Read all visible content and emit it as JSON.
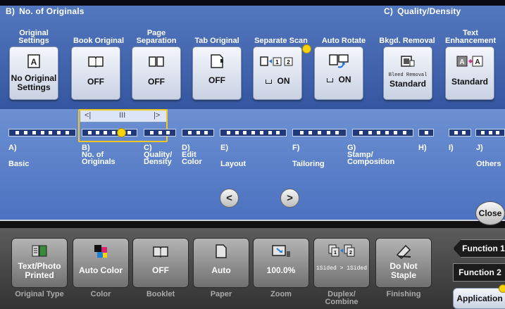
{
  "sections": {
    "b": {
      "letter": "B)",
      "title": "No. of Originals"
    },
    "c": {
      "letter": "C)",
      "title": "Quality/Density"
    }
  },
  "functions": [
    {
      "header": "Original Settings",
      "label": "No Original Settings",
      "icon": "original-settings-icon"
    },
    {
      "header": "Book Original",
      "label": "OFF",
      "icon": "book-original-icon"
    },
    {
      "header": "Page Separation",
      "label": "OFF",
      "icon": "page-separation-icon"
    },
    {
      "header": "Tab Original",
      "label": "OFF",
      "icon": "tab-original-icon"
    },
    {
      "header": "Separate Scan",
      "label": "ON",
      "icon": "separate-scan-icon"
    },
    {
      "header": "Auto Rotate",
      "label": "ON",
      "icon": "auto-rotate-icon"
    },
    {
      "header": "Bkgd. Removal",
      "label": "Standard",
      "sub": "Bleed Removal",
      "icon": "background-removal-icon"
    },
    {
      "header": "Text Enhancement",
      "label": "Standard",
      "icon": "text-enhancement-icon"
    }
  ],
  "menu": [
    {
      "letter": "A)",
      "label": "Basic"
    },
    {
      "letter": "B)",
      "label": "No. of Originals"
    },
    {
      "letter": "C)",
      "label": "Quality/ Density"
    },
    {
      "letter": "D)",
      "label": "Edit Color"
    },
    {
      "letter": "E)",
      "label": "Layout"
    },
    {
      "letter": "F)",
      "label": "Tailoring"
    },
    {
      "letter": "G)",
      "label": "Stamp/ Composition"
    },
    {
      "letter": "H)",
      "label": ""
    },
    {
      "letter": "I)",
      "label": ""
    },
    {
      "letter": "J)",
      "label": "Others"
    }
  ],
  "slider": {
    "left": "<|",
    "mid": "III",
    "right": "|>"
  },
  "nav": {
    "prev": "<",
    "next": ">",
    "close": "Close"
  },
  "quick": [
    {
      "label": "Text/Photo Printed",
      "caption": "Original Type",
      "icon": "text-photo-icon"
    },
    {
      "label": "Auto Color",
      "caption": "Color",
      "icon": "auto-color-icon"
    },
    {
      "label": "OFF",
      "caption": "Booklet",
      "icon": "booklet-icon"
    },
    {
      "label": "Auto",
      "caption": "Paper",
      "icon": "paper-icon"
    },
    {
      "label": "100.0%",
      "caption": "Zoom",
      "icon": "zoom-icon"
    },
    {
      "label": "1Sided > 1Sided",
      "caption": "Duplex/ Combine",
      "icon": "duplex-icon"
    },
    {
      "label": "Do Not Staple",
      "caption": "Finishing",
      "icon": "staple-icon"
    }
  ],
  "tabs": {
    "f1": "Function 1",
    "f2": "Function 2",
    "app": "Application"
  }
}
